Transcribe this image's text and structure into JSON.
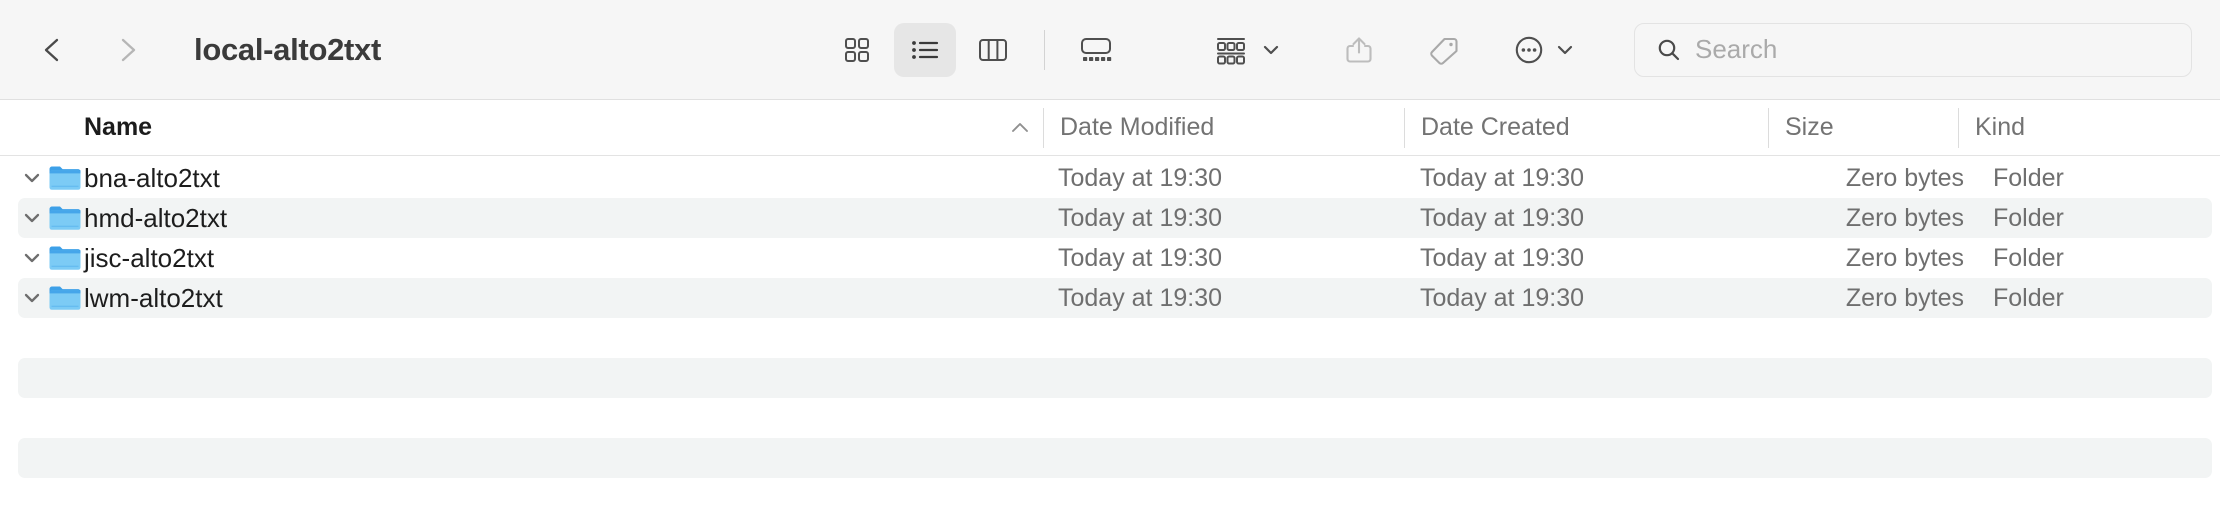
{
  "window": {
    "title": "local-alto2txt"
  },
  "toolbar": {
    "back_label": "Back",
    "forward_label": "Forward",
    "view_modes": [
      {
        "name": "icon-view",
        "label": "Icon View",
        "active": false
      },
      {
        "name": "list-view",
        "label": "List View",
        "active": true
      },
      {
        "name": "column-view",
        "label": "Column View",
        "active": false
      },
      {
        "name": "gallery-view",
        "label": "Gallery View",
        "active": false
      }
    ],
    "actions": [
      {
        "name": "group-by",
        "label": "Group Items",
        "has_chevron": true
      },
      {
        "name": "share",
        "label": "Share",
        "has_chevron": false
      },
      {
        "name": "tags",
        "label": "Edit Tags",
        "has_chevron": false
      },
      {
        "name": "more",
        "label": "More",
        "has_chevron": true
      }
    ]
  },
  "search": {
    "placeholder": "Search",
    "value": ""
  },
  "columns": [
    {
      "key": "name",
      "label": "Name",
      "sorted": true,
      "sort_direction": "ascending"
    },
    {
      "key": "date_modified",
      "label": "Date Modified",
      "sorted": false
    },
    {
      "key": "date_created",
      "label": "Date Created",
      "sorted": false
    },
    {
      "key": "size",
      "label": "Size",
      "sorted": false
    },
    {
      "key": "kind",
      "label": "Kind",
      "sorted": false
    }
  ],
  "files": [
    {
      "name": "bna-alto2txt",
      "date_modified": "Today at 19:30",
      "date_created": "Today at 19:30",
      "size": "Zero bytes",
      "kind": "Folder",
      "icon": "folder-icon",
      "expanded": true,
      "striped": false
    },
    {
      "name": "hmd-alto2txt",
      "date_modified": "Today at 19:30",
      "date_created": "Today at 19:30",
      "size": "Zero bytes",
      "kind": "Folder",
      "icon": "folder-icon",
      "expanded": true,
      "striped": true
    },
    {
      "name": "jisc-alto2txt",
      "date_modified": "Today at 19:30",
      "date_created": "Today at 19:30",
      "size": "Zero bytes",
      "kind": "Folder",
      "icon": "folder-icon",
      "expanded": true,
      "striped": false
    },
    {
      "name": "lwm-alto2txt",
      "date_modified": "Today at 19:30",
      "date_created": "Today at 19:30",
      "size": "Zero bytes",
      "kind": "Folder",
      "icon": "folder-icon",
      "expanded": true,
      "striped": true
    }
  ],
  "empty_stripe_rows": [
    5,
    7
  ],
  "colors": {
    "toolbar_background": "#f6f6f6",
    "list_background": "#ffffff",
    "stripe": "#f2f4f4",
    "folder_tab": "#3da0e8",
    "folder_body": "#7ccbf5",
    "text_primary": "#1d1d1d",
    "text_secondary": "#6f6f6f",
    "divider": "#dcdcdc"
  }
}
